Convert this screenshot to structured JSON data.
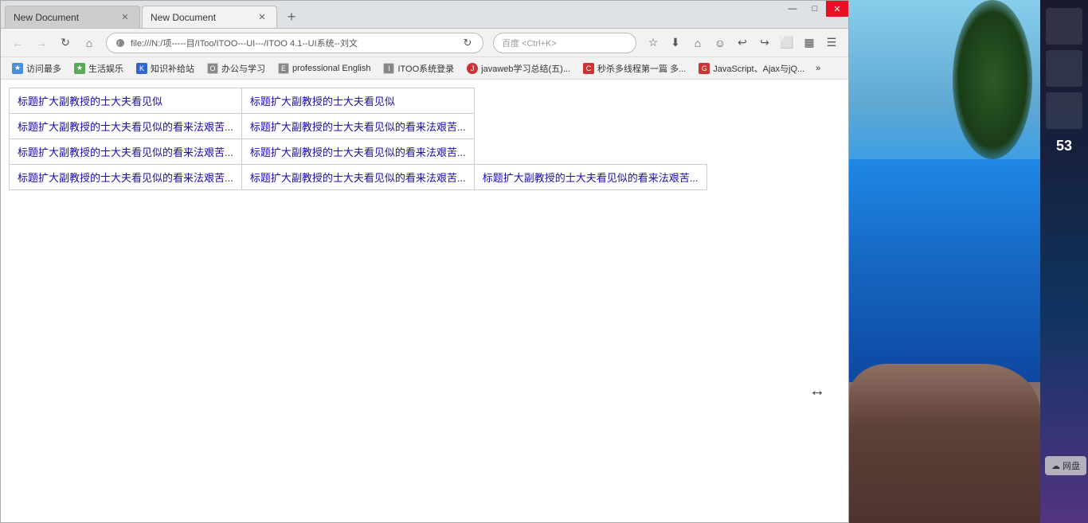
{
  "browser": {
    "tabs": [
      {
        "id": "tab1",
        "title": "New Document",
        "active": false
      },
      {
        "id": "tab2",
        "title": "New Document",
        "active": true
      }
    ],
    "new_tab_label": "+",
    "address": "file:///N:/项-----目/IToo/ITOO---UI---/ITOO 4.1--UI系统--刘文",
    "search_placeholder": "百度 <Ctrl+K>",
    "window_controls": {
      "minimize": "—",
      "maximize": "□",
      "close": "✕"
    }
  },
  "bookmarks": [
    {
      "id": "bm1",
      "label": "访问最多",
      "type": "blue"
    },
    {
      "id": "bm2",
      "label": "生活娱乐",
      "type": "green"
    },
    {
      "id": "bm3",
      "label": "知识补给站",
      "type": "blue2"
    },
    {
      "id": "bm4",
      "label": "办公与学习",
      "type": "gray"
    },
    {
      "id": "bm5",
      "label": "professional English",
      "type": "gray"
    },
    {
      "id": "bm6",
      "label": "ITOO系统登录",
      "type": "gray"
    },
    {
      "id": "bm7",
      "label": "javaweb学习总结(五)...",
      "type": "java"
    },
    {
      "id": "bm8",
      "label": "秒杀多线程第一篇 多...",
      "type": "red"
    },
    {
      "id": "bm9",
      "label": "JavaScript、Ajax与jQ...",
      "type": "red"
    },
    {
      "id": "bm10",
      "label": "»",
      "type": "more"
    }
  ],
  "table": {
    "rows": [
      [
        "标题扩大副教授的士大夫看见似",
        "标题扩大副教授的士大夫看见似",
        ""
      ],
      [
        "标题扩大副教授的士大夫看见似的看来法艰苦...",
        "标题扩大副教授的士大夫看见似的看来法艰苦...",
        ""
      ],
      [
        "标题扩大副教授的士大夫看见似的看来法艰苦...",
        "标题扩大副教授的士大夫看见似的看来法艰苦...",
        ""
      ],
      [
        "标题扩大副教授的士大夫看见似的看来法艰苦...",
        "标题扩大副教授的士大夫看见似的看来法艰苦...",
        "标题扩大副教授的士大夫看见似的看来法艰苦..."
      ]
    ]
  },
  "sidebar": {
    "number": "53",
    "cloud_label": "网盘"
  }
}
